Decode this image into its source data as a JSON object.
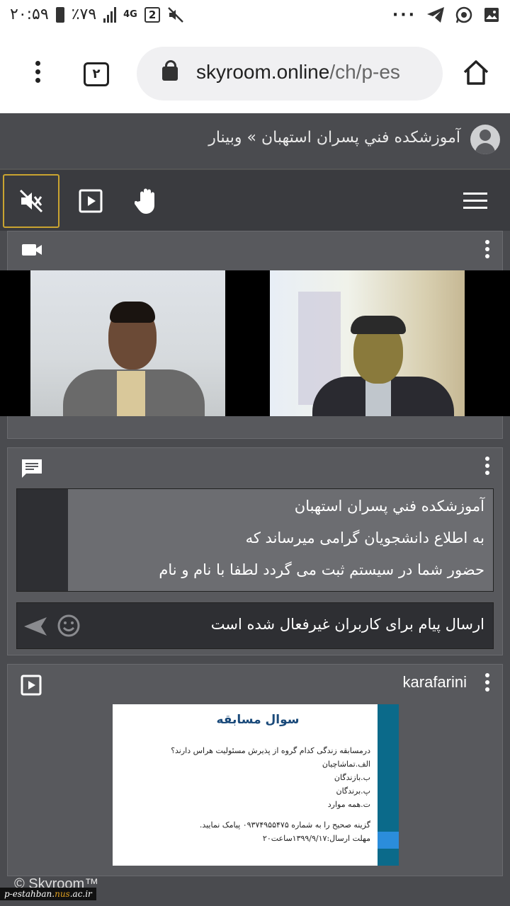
{
  "status_bar": {
    "time": "۲۰:۵۹",
    "battery": "٪۷۹",
    "network": "4G",
    "sim_badge": "2",
    "left_icons": [
      "battery-icon",
      "signal-icon",
      "mute-icon"
    ],
    "right_icons": [
      "more-icon",
      "telegram-icon",
      "whatsapp-icon",
      "gallery-icon"
    ]
  },
  "browser": {
    "tab_count": "۲",
    "url_host": "skyroom.online",
    "url_path": "/ch/p-es"
  },
  "header": {
    "title": "آموزشكده فني پسران استهبان » وبينار"
  },
  "toolbar": {
    "buttons": [
      "audio-mute",
      "presentation",
      "raise-hand"
    ],
    "active_color": "#c9a430"
  },
  "chat": {
    "messages": [
      "آموزشكده فني پسران استهبان",
      "به اطلاع دانشجويان گرامی ميرساند كه",
      "حضور شما در سيستم ثبت می گردد لطفا با نام و نام"
    ],
    "input_status": "ارسال پيام برای كاربران غيرفعال شده است"
  },
  "presentation": {
    "title": "karafarini",
    "slide": {
      "heading": "سوال مسابقه",
      "lines": [
        "درمسابقه زندگی کدام گروه از پذیرش مسئولیت هراس دارند؟",
        "الف.تماشاچیان",
        "ب.بازندگان",
        "پ.برندگان",
        "ت.همه موارد"
      ],
      "footer_lines": [
        "گزینه صحیح را به شماره ۰۹۳۷۴۹۵۵۴۷۵ پیامک نمایید.",
        "مهلت ارسال:۱۳۹۹/۹/۱۷ساعت۲۰"
      ]
    }
  },
  "footer": {
    "brand": "© Skyroom™",
    "watermark_a": "p-estahban.",
    "watermark_b": "nus",
    "watermark_c": ".ac.ir"
  }
}
